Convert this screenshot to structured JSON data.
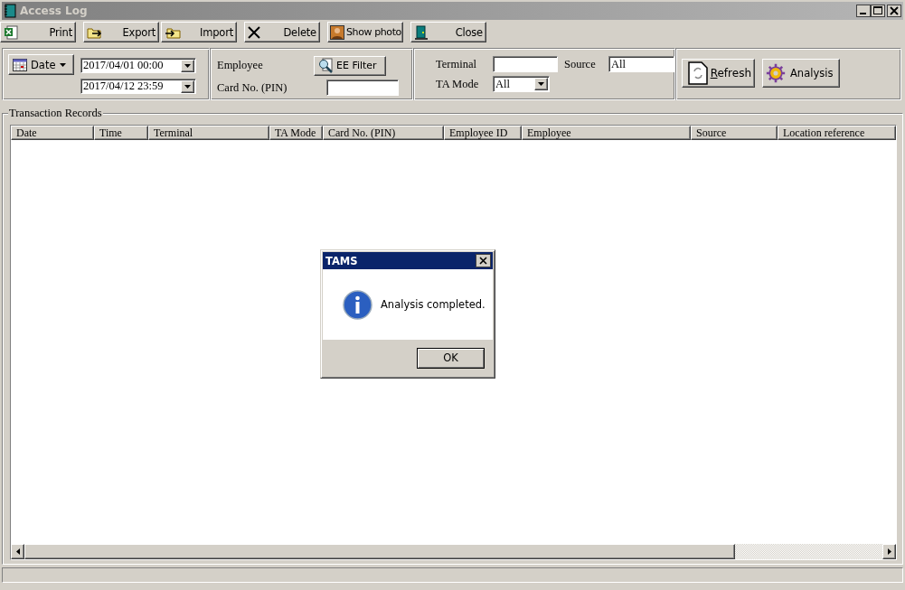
{
  "window": {
    "title": "Access Log"
  },
  "toolbar": [
    {
      "kind": "excel",
      "label": "Print"
    },
    {
      "kind": "export",
      "label": "Export"
    },
    {
      "kind": "import",
      "label": "Import"
    },
    {
      "kind": "delete",
      "label": "Delete"
    },
    {
      "kind": "photo",
      "label": "Show photo"
    },
    {
      "kind": "door",
      "label": "Close"
    }
  ],
  "filters": {
    "date_button": "Date",
    "date_from": "2017/04/01 00:00",
    "date_to": "2017/04/12 23:59",
    "employee_label": "Employee",
    "ee_filter_button": "EE Filter",
    "card_label": "Card No. (PIN)",
    "terminal_label": "Terminal",
    "source_label": "Source",
    "source_value": "All",
    "ta_mode_label": "TA Mode",
    "ta_mode_value": "All"
  },
  "actions": [
    {
      "kind": "refresh",
      "label": "Refresh"
    },
    {
      "kind": "gear",
      "label": "Analysis"
    }
  ],
  "records": {
    "title": "Transaction Records",
    "columns": [
      "Date",
      "Time",
      "Terminal",
      "TA Mode",
      "Card No. (PIN)",
      "Employee ID",
      "Employee",
      "Source",
      "Location reference"
    ]
  },
  "dialog": {
    "title": "TAMS",
    "message": "Analysis completed.",
    "button": "OK"
  }
}
